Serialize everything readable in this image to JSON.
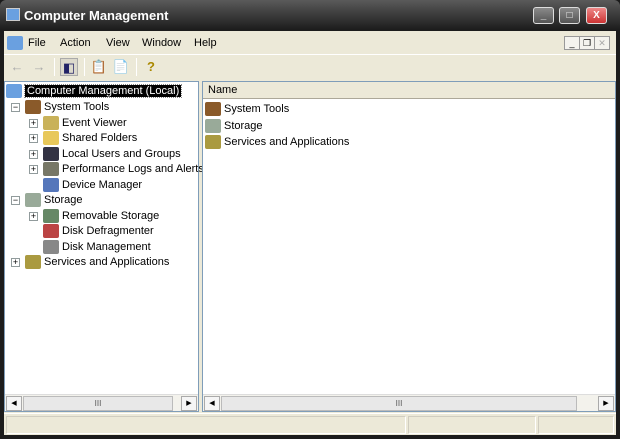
{
  "window": {
    "title": "Computer Management",
    "minimize": "_",
    "maximize": "□",
    "close": "X"
  },
  "menu": [
    "File",
    "Action",
    "View",
    "Window",
    "Help"
  ],
  "mdi": {
    "minimize": "_",
    "restore": "❐",
    "close": "✕"
  },
  "toolbar": {
    "back": "←",
    "forward": "→",
    "show_hide_tree": "◧",
    "properties": "📋",
    "export": "📄",
    "help": "?"
  },
  "tree": {
    "root": "Computer Management (Local)",
    "items": [
      {
        "label": "System Tools",
        "level": 1,
        "expander": "−",
        "icon": "tools-icon"
      },
      {
        "label": "Event Viewer",
        "level": 2,
        "expander": "+",
        "icon": "event-viewer-icon"
      },
      {
        "label": "Shared Folders",
        "level": 2,
        "expander": "+",
        "icon": "folder-icon"
      },
      {
        "label": "Local Users and Groups",
        "level": 2,
        "expander": "+",
        "icon": "users-icon"
      },
      {
        "label": "Performance Logs and Alerts",
        "level": 2,
        "expander": "+",
        "icon": "performance-icon"
      },
      {
        "label": "Device Manager",
        "level": 2,
        "expander": "",
        "icon": "device-manager-icon"
      },
      {
        "label": "Storage",
        "level": 1,
        "expander": "−",
        "icon": "storage-icon"
      },
      {
        "label": "Removable Storage",
        "level": 2,
        "expander": "+",
        "icon": "removable-storage-icon"
      },
      {
        "label": "Disk Defragmenter",
        "level": 2,
        "expander": "",
        "icon": "defrag-icon"
      },
      {
        "label": "Disk Management",
        "level": 2,
        "expander": "",
        "icon": "disk-icon"
      },
      {
        "label": "Services and Applications",
        "level": 1,
        "expander": "+",
        "icon": "services-icon"
      }
    ]
  },
  "list": {
    "header": "Name",
    "items": [
      "System Tools",
      "Storage",
      "Services and Applications"
    ]
  },
  "scroll": {
    "grip": "III",
    "left": "◀",
    "right": "▶"
  }
}
